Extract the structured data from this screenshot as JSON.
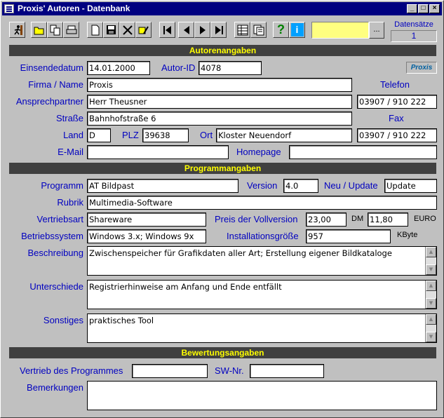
{
  "window": {
    "title": "Proxis' Autoren - Datenbank",
    "min": "_",
    "max": "□",
    "close": "×"
  },
  "toolbar": {
    "datensaetze_label": "Datensätze",
    "datensaetze_value": "1",
    "search_value": "",
    "dots_label": "..."
  },
  "sections": {
    "autoren": "Autorenangaben",
    "programm": "Programmangaben",
    "bewertung": "Bewertungsangaben"
  },
  "autor": {
    "einsendedatum_label": "Einsendedatum",
    "einsendedatum": "14.01.2000",
    "autorid_label": "Autor-ID",
    "autorid": "4078",
    "logo": "Proxis",
    "firma_label": "Firma / Name",
    "firma": "Proxis",
    "telefon_label": "Telefon",
    "ansprech_label": "Ansprechpartner",
    "ansprech": "Herr Theusner",
    "telefon": "03907 / 910 222",
    "strasse_label": "Straße",
    "strasse": "Bahnhofstraße 6",
    "fax_label": "Fax",
    "land_label": "Land",
    "land": "D",
    "plz_label": "PLZ",
    "plz": "39638",
    "ort_label": "Ort",
    "ort": "Kloster Neuendorf",
    "fax": "03907 / 910 222",
    "email_label": "E-Mail",
    "email": "",
    "homepage_label": "Homepage",
    "homepage": ""
  },
  "programm": {
    "programm_label": "Programm",
    "programm": "AT Bildpast",
    "version_label": "Version",
    "version": "4.0",
    "neu_label": "Neu / Update",
    "neu": "Update",
    "rubrik_label": "Rubrik",
    "rubrik": "Multimedia-Software",
    "vertrieb_label": "Vertriebsart",
    "vertrieb": "Shareware",
    "preis_label": "Preis der Vollversion",
    "preis_dm": "23,00",
    "dm": "DM",
    "preis_euro": "11,80",
    "euro": "EURO",
    "os_label": "Betriebssystem",
    "os": "Windows 3.x; Windows 9x",
    "inst_label": "Installationsgröße",
    "inst": "957",
    "kbyte": "KByte",
    "beschreibung_label": "Beschreibung",
    "beschreibung": "Zwischenspeicher für Grafikdaten aller Art; Erstellung eigener Bildkataloge",
    "unterschiede_label": "Unterschiede",
    "unterschiede": "Registrierhinweise am Anfang und Ende entfällt",
    "sonstiges_label": "Sonstiges",
    "sonstiges": "praktisches Tool"
  },
  "bewertung": {
    "vertrieb_label": "Vertrieb des Programmes",
    "vertrieb": "",
    "swnr_label": "SW-Nr.",
    "swnr": "",
    "bemerkungen_label": "Bemerkungen",
    "bemerkungen": ""
  },
  "scroll": {
    "up": "▲",
    "down": "▼"
  }
}
